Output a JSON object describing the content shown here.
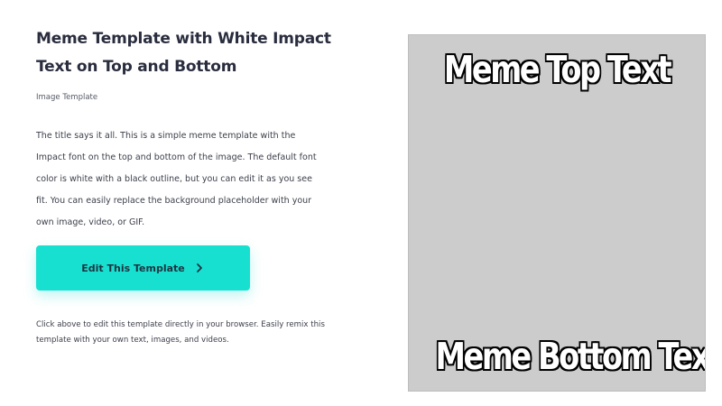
{
  "template": {
    "title": "Meme Template with White Impact Text on Top and Bottom",
    "subtitle": "Image Template",
    "description": "The title says it all. This is a simple meme template with the Impact font on the top and bottom of the image. The default font color is white with a black outline, but you can edit it as you see fit. You can easily replace the background placeholder with your own image, video, or GIF."
  },
  "cta": {
    "label": "Edit This Template",
    "icon": "chevron-right-icon",
    "color": "#18e0d0"
  },
  "note": "Click above to edit this template directly in your browser. Easily remix this template with your own text, images, and videos.",
  "preview": {
    "top_text": "Meme Top Text",
    "bottom_text": "Meme Bottom Text",
    "background_color": "#cccccc"
  }
}
